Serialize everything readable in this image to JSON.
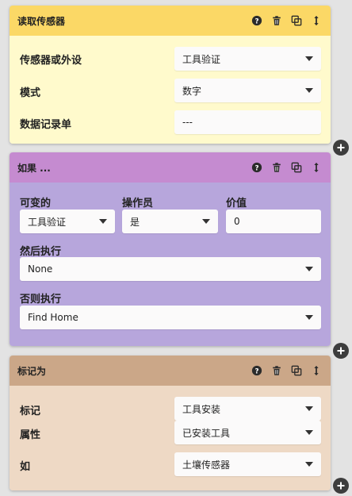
{
  "blocks": [
    {
      "title": "读取传感器",
      "rows": [
        {
          "label": "传感器或外设",
          "value": "工具验证"
        },
        {
          "label": "模式",
          "value": "数字"
        },
        {
          "label": "数据记录单",
          "value": "---"
        }
      ]
    },
    {
      "title": "如果 ...",
      "cols": [
        {
          "label": "可变的",
          "value": "工具验证"
        },
        {
          "label": "操作员",
          "value": "是"
        },
        {
          "label": "价值",
          "value": "0"
        }
      ],
      "then_label": "然后执行",
      "then_value": "None",
      "else_label": "否则执行",
      "else_value": "Find Home"
    },
    {
      "title": "标记为",
      "rows": [
        {
          "label": "标记",
          "value": "工具安装"
        },
        {
          "label": "属性",
          "value": "已安装工具"
        },
        {
          "label": "如",
          "value": "土壤传感器"
        }
      ]
    }
  ],
  "icons": {
    "help": "help-circle-icon",
    "delete": "trash-icon",
    "duplicate": "copy-icon",
    "move": "vertical-arrows-icon",
    "add": "plus-circle-icon",
    "dropdown": "caret-down-icon"
  },
  "colors": {
    "read_sensor_header": "#fbd866",
    "read_sensor_body": "#fffacc",
    "if_header": "#c58bd0",
    "if_body": "#b7a6dc",
    "mark_as_header": "#cba788",
    "mark_as_body": "#eed9c5"
  }
}
